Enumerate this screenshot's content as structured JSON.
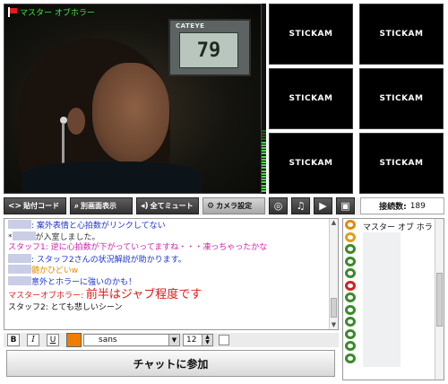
{
  "broadcaster": {
    "name": "マスター オブホラー"
  },
  "video": {
    "device_brand": "CATEYE",
    "device_reading": "79"
  },
  "thumbnails": [
    {
      "label": "STICKAM"
    },
    {
      "label": "STICKAM"
    },
    {
      "label": "STICKAM"
    },
    {
      "label": "STICKAM"
    },
    {
      "label": "STICKAM"
    },
    {
      "label": "STICKAM"
    }
  ],
  "toolbar": {
    "embed_code": "貼付コード",
    "popout": "別画面表示",
    "mute_all": "全てミュート",
    "camera_settings": "カメラ設定",
    "viewer_count_label": "接続数:",
    "viewer_count_value": "189"
  },
  "chat": {
    "messages": [
      {
        "user": "",
        "text": ": 案外表情と心拍数がリンクしてない",
        "color": "#1a33d6"
      },
      {
        "user": "*",
        "text": "が入室しました。",
        "color": "#333333"
      },
      {
        "user": "スタッフ1",
        "text": "スタッフ1: 逆に心拍数が下がっていってますね・・・凍っちゃったかな",
        "color": "#cc22aa"
      },
      {
        "user": "",
        "text": ": スタッフ2さんの状況解説が助かります。",
        "color": "#1a33d6"
      },
      {
        "user": "",
        "text": "髄かひどいw",
        "color": "#e08a00"
      },
      {
        "user": "",
        "text": "意外とホラーに強いのかも！",
        "color": "#1a33d6"
      },
      {
        "user": "マスターオブホラー",
        "prefix": "マスターオブホラー: ",
        "text": "前半はジャブ程度です",
        "color": "#e01818"
      },
      {
        "user": "スタッフ2",
        "text": "スタッフ2: とても悲しいシーン",
        "color": "#111111"
      }
    ]
  },
  "viewers": {
    "first": "マスター オブ ホラ"
  },
  "format": {
    "bold": "B",
    "italic": "I",
    "underline": "U",
    "font": "sans",
    "size": "12",
    "text_color": "#f07c00"
  },
  "join_button": "チャットに参加"
}
